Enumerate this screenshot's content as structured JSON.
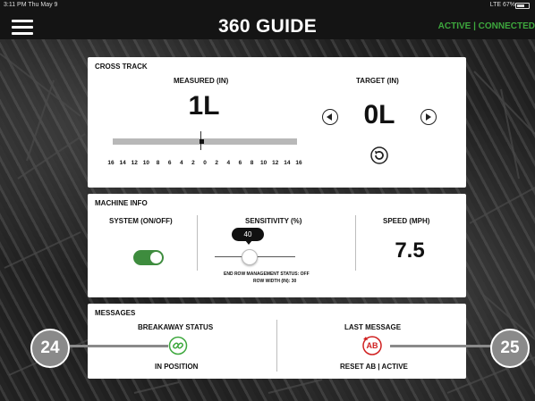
{
  "status_bar": {
    "time": "3:11 PM  Thu May 9",
    "right": "LTE 67%"
  },
  "header": {
    "title": "360 GUIDE",
    "connection": "ACTIVE | CONNECTED"
  },
  "cross_track": {
    "title": "CROSS TRACK",
    "measured_label": "MEASURED (IN)",
    "measured_value": "1L",
    "target_label": "TARGET (IN)",
    "target_value": "0L",
    "scale": [
      "16",
      "14",
      "12",
      "10",
      "8",
      "6",
      "4",
      "2",
      "0",
      "2",
      "4",
      "6",
      "8",
      "10",
      "12",
      "14",
      "16"
    ]
  },
  "machine_info": {
    "title": "MACHINE INFO",
    "system_label": "SYSTEM (ON/OFF)",
    "system_on": true,
    "sensitivity_label": "SENSITIVITY (%)",
    "sensitivity_value": "40",
    "end_row_status": "END ROW MANAGEMENT STATUS: OFF",
    "row_width": "ROW WIDTH (IN): 30",
    "speed_label": "SPEED (MPH)",
    "speed_value": "7.5"
  },
  "messages": {
    "title": "MESSAGES",
    "breakaway_label": "BREAKAWAY STATUS",
    "breakaway_status": "IN POSITION",
    "last_message_label": "LAST MESSAGE",
    "ab_icon_text": "AB",
    "last_message_value": "RESET AB | ACTIVE"
  },
  "callouts": {
    "left": "24",
    "right": "25"
  },
  "colors": {
    "accent_green": "#3da83d",
    "alert_red": "#d02020",
    "callout_gray": "#8a8a8a"
  }
}
